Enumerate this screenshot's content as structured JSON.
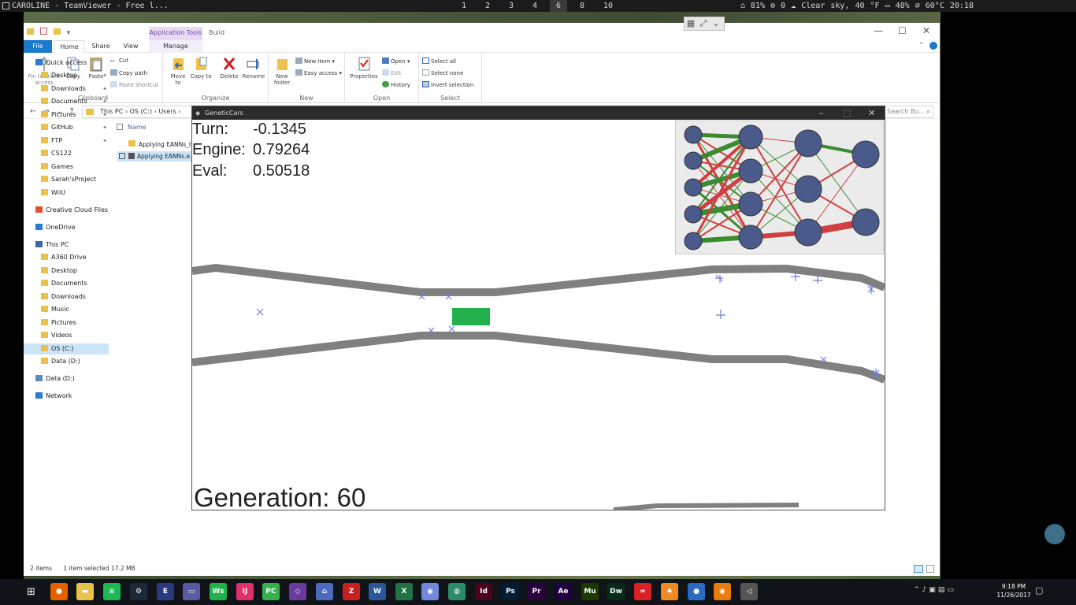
{
  "topbar": {
    "title": "CAROLINE - TeamViewer - Free l...",
    "workspaces": [
      "1",
      "2",
      "3",
      "4",
      "6",
      "8",
      "10"
    ],
    "active_workspace": "6",
    "status": "⌂ 81% ⚙ 0 ☁ Clear sky, 40 °F ▭ 48% ⌀ 60°C 20:18"
  },
  "explorer": {
    "tabs": {
      "file": "File",
      "home": "Home",
      "share": "Share",
      "view": "View",
      "manage": "Manage",
      "app_tools": "Application Tools",
      "build": "Build"
    },
    "clipboard": {
      "pin": "Pin to Quick access",
      "copy": "Copy",
      "paste": "Paste",
      "cut": "Cut",
      "copy_path": "Copy path",
      "paste_shortcut": "Paste shortcut",
      "label": "Clipboard"
    },
    "organize": {
      "move_to": "Move to",
      "copy_to": "Copy to",
      "delete": "Delete",
      "rename": "Rename",
      "label": "Organize"
    },
    "new": {
      "new_folder": "New folder",
      "new_item": "New item ▾",
      "easy_access": "Easy access ▾",
      "label": "New"
    },
    "open": {
      "properties": "Properties",
      "open": "Open ▾",
      "edit": "Edit",
      "history": "History",
      "label": "Open"
    },
    "select": {
      "select_all": "Select all",
      "select_none": "Select none",
      "invert": "Invert selection",
      "label": "Select"
    },
    "address": "This PC  ›  OS (C:)  ›  Users  ›",
    "search_placeholder": "Search Bu...",
    "nav": [
      {
        "label": "Quick access",
        "indent": 0,
        "pin": false
      },
      {
        "label": "Desktop",
        "indent": 1,
        "pin": true
      },
      {
        "label": "Downloads",
        "indent": 1,
        "pin": true
      },
      {
        "label": "Documents",
        "indent": 1,
        "pin": true
      },
      {
        "label": "Pictures",
        "indent": 1,
        "pin": true
      },
      {
        "label": "GitHub",
        "indent": 1,
        "pin": true
      },
      {
        "label": "FTP",
        "indent": 1,
        "pin": true
      },
      {
        "label": "CS122",
        "indent": 1,
        "pin": false
      },
      {
        "label": "Games",
        "indent": 1,
        "pin": false
      },
      {
        "label": "Sarah'sProject",
        "indent": 1,
        "pin": false
      },
      {
        "label": "WiiU",
        "indent": 1,
        "pin": false
      },
      {
        "label": "Creative Cloud Files",
        "indent": 0,
        "pin": false
      },
      {
        "label": "OneDrive",
        "indent": 0,
        "pin": false
      },
      {
        "label": "This PC",
        "indent": 0,
        "pin": false
      },
      {
        "label": "A360 Drive",
        "indent": 1,
        "pin": false
      },
      {
        "label": "Desktop",
        "indent": 1,
        "pin": false
      },
      {
        "label": "Documents",
        "indent": 1,
        "pin": false
      },
      {
        "label": "Downloads",
        "indent": 1,
        "pin": false
      },
      {
        "label": "Music",
        "indent": 1,
        "pin": false
      },
      {
        "label": "Pictures",
        "indent": 1,
        "pin": false
      },
      {
        "label": "Videos",
        "indent": 1,
        "pin": false
      },
      {
        "label": "OS (C:)",
        "indent": 1,
        "pin": false,
        "selected": true
      },
      {
        "label": "Data (D:)",
        "indent": 1,
        "pin": false
      },
      {
        "label": "Data (D:)",
        "indent": 0,
        "pin": false
      },
      {
        "label": "Network",
        "indent": 0,
        "pin": false
      }
    ],
    "column_name": "Name",
    "files": [
      "Applying EANNs_I",
      "Applying EANNs.e"
    ],
    "status": {
      "items": "2 items",
      "selected": "1 item selected  17.2 MB"
    }
  },
  "geneticcars": {
    "title": "GeneticCars",
    "turn_label": "Turn:",
    "turn_value": "-0.1345",
    "engine_label": "Engine:",
    "engine_value": "0.79264",
    "eval_label": "Eval:",
    "eval_value": "0.50518",
    "generation": "Generation: 60"
  },
  "taskbar": {
    "apps": [
      "E",
      "Ws",
      "IJ",
      "PC",
      "Id",
      "Ps",
      "Pr",
      "Ae",
      "Mu",
      "Dw"
    ],
    "time": "9:18 PM",
    "date": "11/26/2017"
  },
  "colors": {
    "track": "#808080",
    "car": "#22b14c",
    "node": "#4a5a8a",
    "pos_weight": "#3c8a32",
    "neg_weight": "#d04040",
    "sensor": "#6b7be0"
  }
}
